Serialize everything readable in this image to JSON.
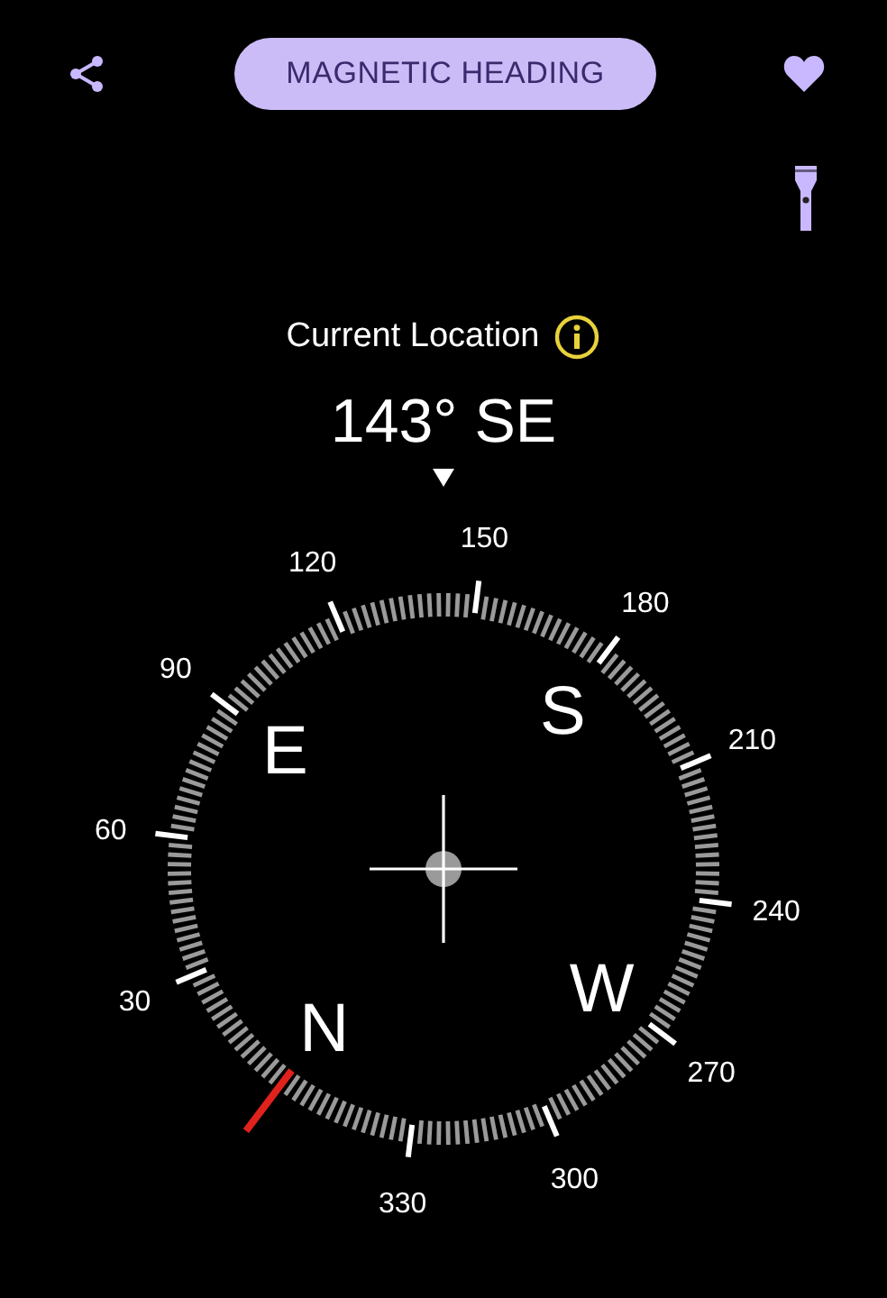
{
  "top_bar": {
    "mode_button": "MAGNETIC HEADING"
  },
  "location": {
    "label": "Current Location"
  },
  "heading": "143° SE",
  "dial": {
    "degree_labels": [
      "30",
      "60",
      "90",
      "120",
      "150",
      "180",
      "210",
      "240",
      "270",
      "300",
      "330"
    ],
    "cardinals": [
      "E",
      "S",
      "N",
      "W"
    ]
  }
}
